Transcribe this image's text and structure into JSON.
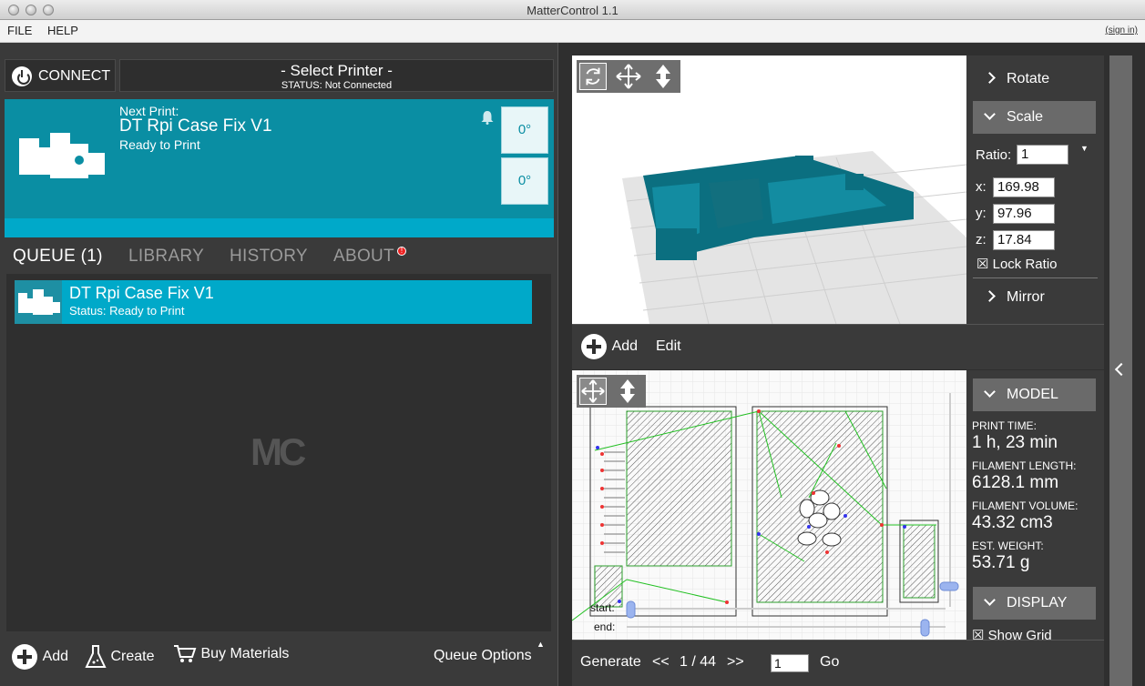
{
  "window": {
    "title": "MatterControl 1.1"
  },
  "menu": {
    "file": "FILE",
    "help": "HELP",
    "signin": "(sign in)"
  },
  "printer": {
    "connect_label": "CONNECT",
    "select_label": "- Select Printer -",
    "status": "STATUS: Not Connected"
  },
  "next_print": {
    "label": "Next Print:",
    "name": "DT Rpi Case Fix V1",
    "status": "Ready to Print",
    "extruder_temp": "0°",
    "bed_temp": "0°"
  },
  "tabs": [
    {
      "label": "QUEUE (1)",
      "active": true
    },
    {
      "label": "LIBRARY",
      "active": false
    },
    {
      "label": "HISTORY",
      "active": false
    },
    {
      "label": "ABOUT",
      "active": false
    }
  ],
  "about_badge": "!",
  "queue": {
    "items": [
      {
        "name": "DT Rpi Case Fix V1",
        "status": "Status: Ready to Print"
      }
    ],
    "logo": "MC"
  },
  "queue_footer": {
    "add": "Add",
    "create": "Create",
    "buy": "Buy Materials",
    "options": "Queue Options"
  },
  "view3d_footer": {
    "add": "Add",
    "edit": "Edit"
  },
  "transform": {
    "rotate": "Rotate",
    "scale": "Scale",
    "ratio_label": "Ratio:",
    "ratio_value": "1",
    "x_label": "x:",
    "x_value": "169.98",
    "y_label": "y:",
    "y_value": "97.96",
    "z_label": "z:",
    "z_value": "17.84",
    "lock_ratio": "Lock Ratio",
    "mirror": "Mirror"
  },
  "layer_view": {
    "start_label": "start:",
    "end_label": "end:",
    "generate": "Generate",
    "prev": "<<",
    "layer_display": "1 / 44",
    "next": ">>",
    "goto_value": "1",
    "go": "Go"
  },
  "model": {
    "header": "MODEL",
    "print_time_label": "PRINT TIME:",
    "print_time": "1 h, 23 min",
    "filament_length_label": "FILAMENT LENGTH:",
    "filament_length": "6128.1 mm",
    "filament_volume_label": "FILAMENT VOLUME:",
    "filament_volume": "43.32 cm3",
    "weight_label": "EST. WEIGHT:",
    "weight": "53.71 g",
    "display_header": "DISPLAY",
    "show_grid": "Show Grid"
  },
  "colors": {
    "accent": "#0a8ea3",
    "queue_item": "#00a9c9",
    "panel_bg": "#3a3a3a"
  }
}
